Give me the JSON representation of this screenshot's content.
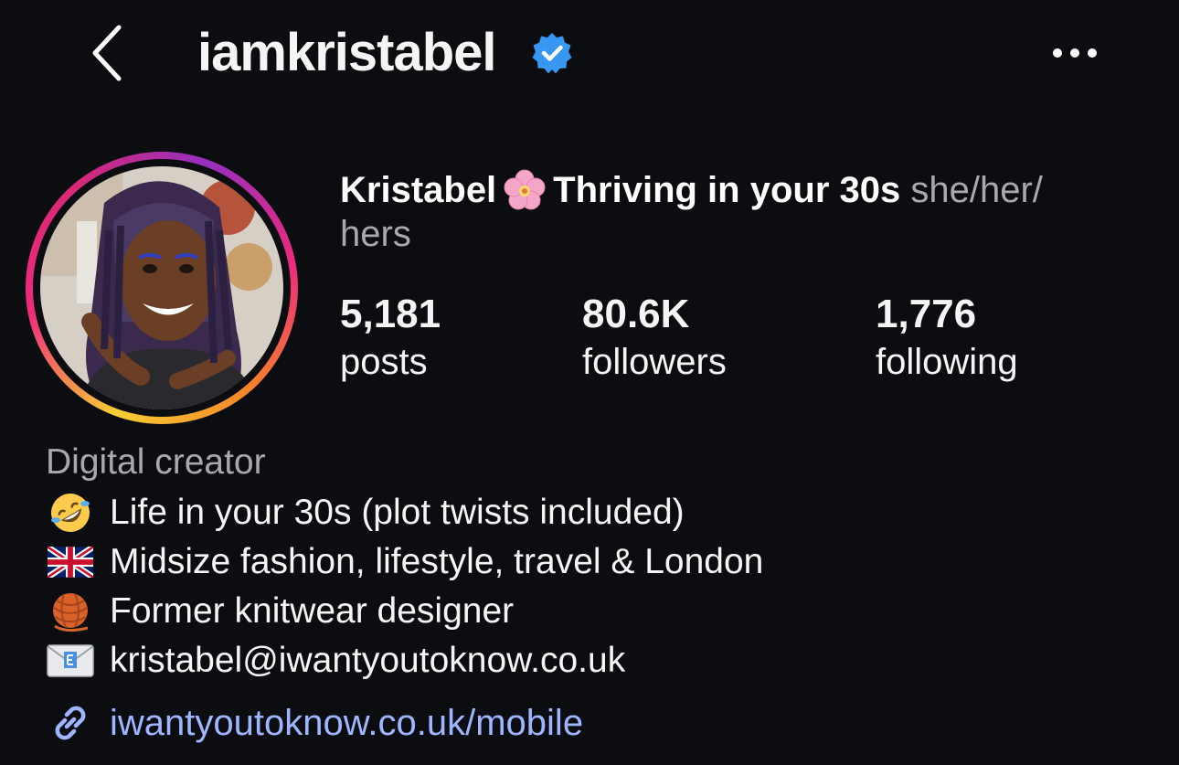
{
  "header": {
    "username": "iamkristabel",
    "verified_icon": "verified-badge-icon",
    "back_icon": "chevron-left-icon",
    "more_icon": "more-horizontal-icon"
  },
  "profile": {
    "name": "Kristabel",
    "name_emoji": "cherry-blossom-icon",
    "tagline": "Thriving in your 30s",
    "pronouns_part1": "she/her/",
    "pronouns_part2": "hers"
  },
  "stats": [
    {
      "value": "5,181",
      "label": "posts"
    },
    {
      "value": "80.6K",
      "label": "followers"
    },
    {
      "value": "1,776",
      "label": "following"
    }
  ],
  "bio": {
    "category": "Digital creator",
    "lines": [
      {
        "icon": "rolling-laughing-emoji-icon",
        "text": "Life in your 30s (plot twists included)"
      },
      {
        "icon": "uk-flag-icon",
        "text": "Midsize fashion, lifestyle, travel & London"
      },
      {
        "icon": "yarn-ball-icon",
        "text": "Former knitwear designer"
      },
      {
        "icon": "envelope-icon",
        "text": "kristabel@iwantyoutoknow.co.uk"
      }
    ],
    "link": {
      "icon": "link-icon",
      "text": "iwantyoutoknow.co.uk/mobile"
    }
  },
  "colors": {
    "background": "#0c0d10",
    "verified": "#3897f0",
    "link": "#9fb5ff",
    "secondary_text": "#a8a8ad"
  }
}
